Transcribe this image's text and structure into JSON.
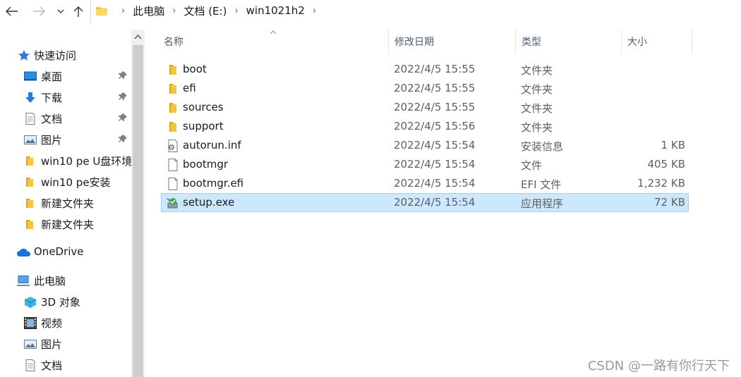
{
  "address_bar": {
    "breadcrumbs": [
      "此电脑",
      "文档 (E:)",
      "win1021h2"
    ]
  },
  "icons": {
    "back": "arrow-left-icon",
    "forward": "arrow-right-icon",
    "recent": "chevron-down-icon",
    "up": "arrow-up-icon",
    "folder": "folder-icon",
    "pin": "pin-icon"
  },
  "colors": {
    "folder_yellow": "#f4c542",
    "selection_bg": "#cce8ff",
    "selection_border": "#99d1ff",
    "header_text": "#4c607a"
  },
  "sidebar": {
    "items": [
      {
        "label": "快速访问",
        "icon": "star-icon"
      },
      {
        "label": "桌面",
        "icon": "desktop-icon",
        "pinned": true
      },
      {
        "label": "下载",
        "icon": "download-icon",
        "pinned": true
      },
      {
        "label": "文档",
        "icon": "document-icon",
        "pinned": true
      },
      {
        "label": "图片",
        "icon": "pictures-icon",
        "pinned": true
      },
      {
        "label": "win10 pe U盘环境",
        "icon": "folder-icon"
      },
      {
        "label": "win10 pe安装",
        "icon": "folder-icon"
      },
      {
        "label": "新建文件夹",
        "icon": "folder-icon"
      },
      {
        "label": "新建文件夹",
        "icon": "folder-icon"
      },
      {
        "label": "OneDrive",
        "icon": "cloud-icon"
      },
      {
        "label": "此电脑",
        "icon": "computer-icon"
      },
      {
        "label": "3D 对象",
        "icon": "cube-icon"
      },
      {
        "label": "视频",
        "icon": "video-icon"
      },
      {
        "label": "图片",
        "icon": "pictures-icon"
      },
      {
        "label": "文档",
        "icon": "document-icon"
      }
    ]
  },
  "file_list": {
    "columns": [
      "名称",
      "修改日期",
      "类型",
      "大小"
    ],
    "rows": [
      {
        "name": "boot",
        "date": "2022/4/5 15:55",
        "type": "文件夹",
        "size": "",
        "icon": "folder-icon"
      },
      {
        "name": "efi",
        "date": "2022/4/5 15:55",
        "type": "文件夹",
        "size": "",
        "icon": "folder-icon"
      },
      {
        "name": "sources",
        "date": "2022/4/5 15:55",
        "type": "文件夹",
        "size": "",
        "icon": "folder-icon"
      },
      {
        "name": "support",
        "date": "2022/4/5 15:56",
        "type": "文件夹",
        "size": "",
        "icon": "folder-icon"
      },
      {
        "name": "autorun.inf",
        "date": "2022/4/5 15:54",
        "type": "安装信息",
        "size": "1 KB",
        "icon": "settings-file-icon"
      },
      {
        "name": "bootmgr",
        "date": "2022/4/5 15:54",
        "type": "文件",
        "size": "405 KB",
        "icon": "file-icon"
      },
      {
        "name": "bootmgr.efi",
        "date": "2022/4/5 15:54",
        "type": "EFI 文件",
        "size": "1,232 KB",
        "icon": "file-icon"
      },
      {
        "name": "setup.exe",
        "date": "2022/4/5 15:54",
        "type": "应用程序",
        "size": "72 KB",
        "icon": "setup-icon",
        "selected": true
      }
    ]
  },
  "watermark": "CSDN @一路有你行天下"
}
